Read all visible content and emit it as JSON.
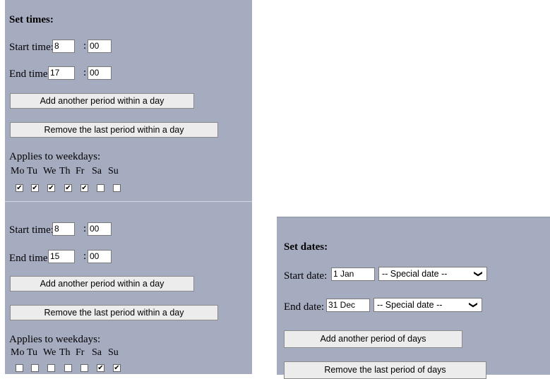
{
  "times": {
    "title": "Set times:",
    "periods": [
      {
        "start_label": "Start time:",
        "start_hour": "8",
        "start_min": "00",
        "end_label": "End time:",
        "end_hour": "17",
        "end_min": "00",
        "colon": ":",
        "add_label": "Add another period within a day",
        "remove_label": "Remove the last period within a day",
        "weekdays_label": "Applies to weekdays:",
        "days": [
          "Mo",
          "Tu",
          "We",
          "Th",
          "Fr",
          "Sa",
          "Su"
        ],
        "checked": [
          true,
          true,
          true,
          true,
          true,
          false,
          false
        ]
      },
      {
        "start_label": "Start time:",
        "start_hour": "8",
        "start_min": "00",
        "end_label": "End time:",
        "end_hour": "15",
        "end_min": "00",
        "colon": ":",
        "add_label": "Add another period within a day",
        "remove_label": "Remove the last period within a day",
        "weekdays_label": "Applies to weekdays:",
        "days": [
          "Mo",
          "Tu",
          "We",
          "Th",
          "Fr",
          "Sa",
          "Su"
        ],
        "checked": [
          false,
          false,
          false,
          false,
          false,
          true,
          true
        ]
      }
    ]
  },
  "dates": {
    "title": "Set dates:",
    "start_label": "Start date:",
    "start_value": "1 Jan",
    "start_special": "-- Special date --",
    "end_label": "End date:",
    "end_value": "31 Dec",
    "end_special": "-- Special date --",
    "add_label": "Add another period of days",
    "remove_label": "Remove the last period of days"
  },
  "colors": {
    "panel": "#a6acc0",
    "button": "#ececec"
  }
}
